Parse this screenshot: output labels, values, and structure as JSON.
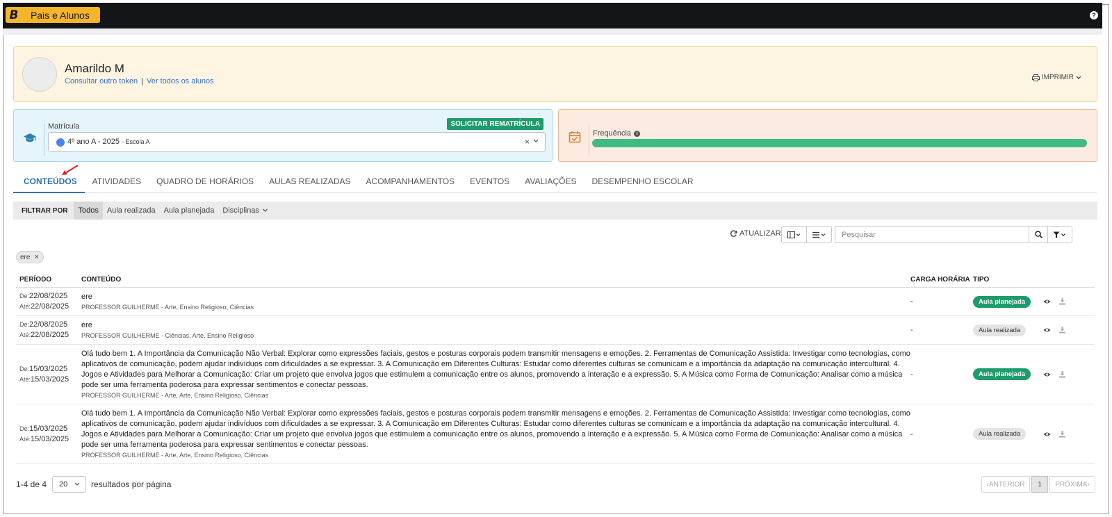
{
  "app": {
    "title": "Pais e Alunos",
    "logo_letter": "B",
    "help_icon": "question-icon"
  },
  "student": {
    "name": "Amarildo M",
    "link_other_token": "Consultar outro token",
    "link_all_students": "Ver todos os alunos",
    "print_label": "IMPRIMIR"
  },
  "matricula": {
    "label": "Matrícula",
    "rematricula_button": "SOLICITAR REMATRÍCULA",
    "selected_class": "4º ano A - 2025",
    "selected_school": "- Escola A",
    "clear_icon": "×"
  },
  "frequencia": {
    "label": "Frequência",
    "level": 1.0
  },
  "tabs": [
    {
      "label": "CONTEÚDOS",
      "active": true
    },
    {
      "label": "ATIVIDADES"
    },
    {
      "label": "QUADRO DE HORÁRIOS"
    },
    {
      "label": "AULAS REALIZADAS"
    },
    {
      "label": "ACOMPANHAMENTOS"
    },
    {
      "label": "EVENTOS"
    },
    {
      "label": "AVALIAÇÕES"
    },
    {
      "label": "DESEMPENHO ESCOLAR"
    }
  ],
  "filter": {
    "title": "FILTRAR POR",
    "options": [
      "Todos",
      "Aula realizada",
      "Aula planejada",
      "Disciplinas"
    ]
  },
  "toolbar": {
    "update_label": "ATUALIZAR",
    "search_placeholder": "Pesquisar"
  },
  "chips": [
    {
      "label": "ere"
    }
  ],
  "table": {
    "headers": {
      "periodo": "PERÍODO",
      "conteudo": "CONTEÚDO",
      "carga": "CARGA HORÁRIA",
      "tipo": "TIPO"
    },
    "from_label": "De:",
    "to_label": "Até:",
    "rows": [
      {
        "from": "22/08/2025",
        "to": "22/08/2025",
        "content": "ere",
        "prof": "PROFESSOR GUILHERME - Arte, Ensino Religioso, Ciências",
        "carga": "-",
        "tipo": "Aula planejada",
        "tipo_class": "plan"
      },
      {
        "from": "22/08/2025",
        "to": "22/08/2025",
        "content": "ere",
        "prof": "PROFESSOR GUILHERME - Ciências, Arte, Ensino Religioso",
        "carga": "-",
        "tipo": "Aula realizada",
        "tipo_class": "real"
      },
      {
        "from": "15/03/2025",
        "to": "15/03/2025",
        "content": "Olá tudo bem 1. A Importância da Comunicação Não Verbal: Explorar como expressões faciais, gestos e posturas corporais podem transmitir mensagens e emoções. 2. Ferramentas de Comunicação Assistida: Investigar como tecnologias, como aplicativos de comunicação, podem ajudar indivíduos com dificuldades a se expressar. 3. A Comunicação em Diferentes Culturas: Estudar como diferentes culturas se comunicam e a importância da adaptação na comunicação intercultural. 4. Jogos e Atividades para Melhorar a Comunicação: Criar um projeto que envolva jogos que estimulem a comunicação entre os alunos, promovendo a interação e a expressão. 5. A Música como Forma de Comunicação: Analisar como a música pode ser uma ferramenta poderosa para expressar sentimentos e conectar pessoas.",
        "prof": "PROFESSOR GUILHERME - Arte, Arte, Ensino Religioso, Ciências",
        "carga": "-",
        "tipo": "Aula planejada",
        "tipo_class": "plan"
      },
      {
        "from": "15/03/2025",
        "to": "15/03/2025",
        "content": "Olá tudo bem 1. A Importância da Comunicação Não Verbal: Explorar como expressões faciais, gestos e posturas corporais podem transmitir mensagens e emoções. 2. Ferramentas de Comunicação Assistida: Investigar como tecnologias, como aplicativos de comunicação, podem ajudar indivíduos com dificuldades a se expressar. 3. A Comunicação em Diferentes Culturas: Estudar como diferentes culturas se comunicam e a importância da adaptação na comunicação intercultural. 4. Jogos e Atividades para Melhorar a Comunicação: Criar um projeto que envolva jogos que estimulem a comunicação entre os alunos, promovendo a interação e a expressão. 5. A Música como Forma de Comunicação: Analisar como a música pode ser uma ferramenta poderosa para expressar sentimentos e conectar pessoas.",
        "prof": "PROFESSOR GUILHERME - Arte, Arte, Ensino Religioso, Ciências",
        "carga": "-",
        "tipo": "Aula realizada",
        "tipo_class": "real"
      }
    ]
  },
  "footer": {
    "count": "1-4 de 4",
    "page_size": "20",
    "per_page_label": "resultados por página",
    "prev_label": "ANTERIOR",
    "current_page": "1",
    "next_label": "PRÓXIMA"
  },
  "colors": {
    "brand": "#f5b52a",
    "topbar": "#141518",
    "accent": "#2d6fbc",
    "success": "#1d9c6c",
    "frequency_bar": "#3dbb83"
  }
}
